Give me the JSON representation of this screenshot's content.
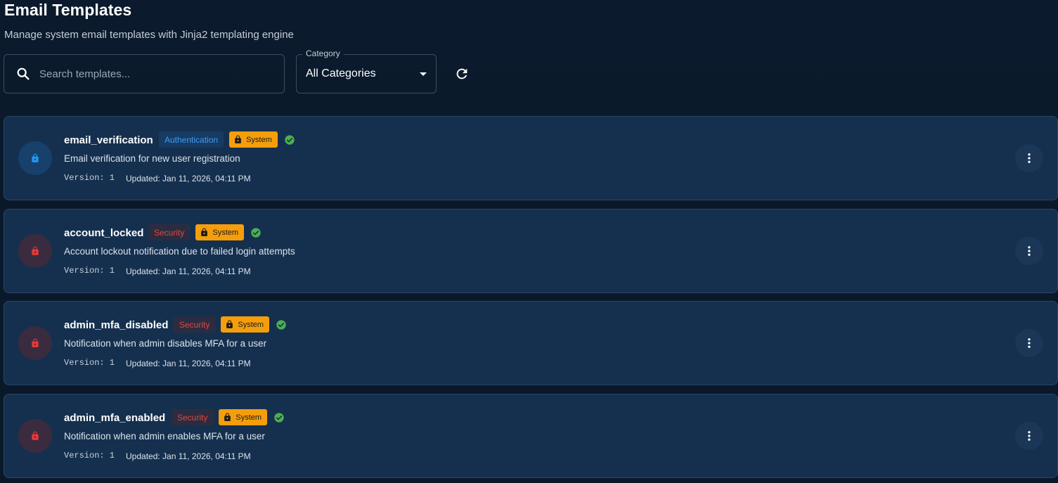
{
  "header": {
    "title": "Email Templates",
    "subtitle": "Manage system email templates with Jinja2 templating engine"
  },
  "filters": {
    "search_placeholder": "Search templates...",
    "category_label": "Category",
    "category_value": "All Categories"
  },
  "colors": {
    "card_bg": "#15304f",
    "auth_accent": "#2196f3",
    "security_accent": "#e53935",
    "system_badge": "#f59e0b",
    "active_check": "#4caf50"
  },
  "templates": [
    {
      "name": "email_verification",
      "category": "Authentication",
      "system_label": "System",
      "description": "Email verification for new user registration",
      "version": "Version: 1",
      "updated": "Updated: Jan 11, 2026, 04:11 PM",
      "icon": "lock-icon",
      "active": true
    },
    {
      "name": "account_locked",
      "category": "Security",
      "system_label": "System",
      "description": "Account lockout notification due to failed login attempts",
      "version": "Version: 1",
      "updated": "Updated: Jan 11, 2026, 04:11 PM",
      "icon": "lock-icon",
      "active": true
    },
    {
      "name": "admin_mfa_disabled",
      "category": "Security",
      "system_label": "System",
      "description": "Notification when admin disables MFA for a user",
      "version": "Version: 1",
      "updated": "Updated: Jan 11, 2026, 04:11 PM",
      "icon": "lock-icon",
      "active": true
    },
    {
      "name": "admin_mfa_enabled",
      "category": "Security",
      "system_label": "System",
      "description": "Notification when admin enables MFA for a user",
      "version": "Version: 1",
      "updated": "Updated: Jan 11, 2026, 04:11 PM",
      "icon": "lock-icon",
      "active": true
    }
  ]
}
